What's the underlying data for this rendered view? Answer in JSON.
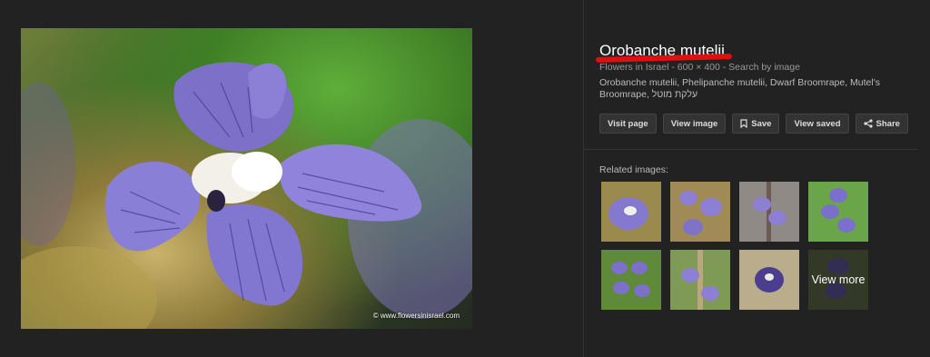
{
  "result": {
    "title": "Orobanche mutelii",
    "source": "Flowers in Israel",
    "dimensions": "600 × 400",
    "search_by_image": "Search by image",
    "separator": "-",
    "description": "Orobanche mutelii, Phelipanche mutelii, Dwarf Broomrape, Mutel's Broomrape, עלקת מוטל",
    "watermark": "© www.flowersinisrael.com"
  },
  "buttons": {
    "visit": "Visit page",
    "view_image": "View image",
    "save": "Save",
    "view_saved": "View saved",
    "share": "Share"
  },
  "related": {
    "label": "Related images:",
    "view_more": "View more"
  },
  "colors": {
    "background": "#222222",
    "button_bg": "#333333",
    "underline": "#e01010",
    "flower_purple": "#8a7fd6"
  }
}
